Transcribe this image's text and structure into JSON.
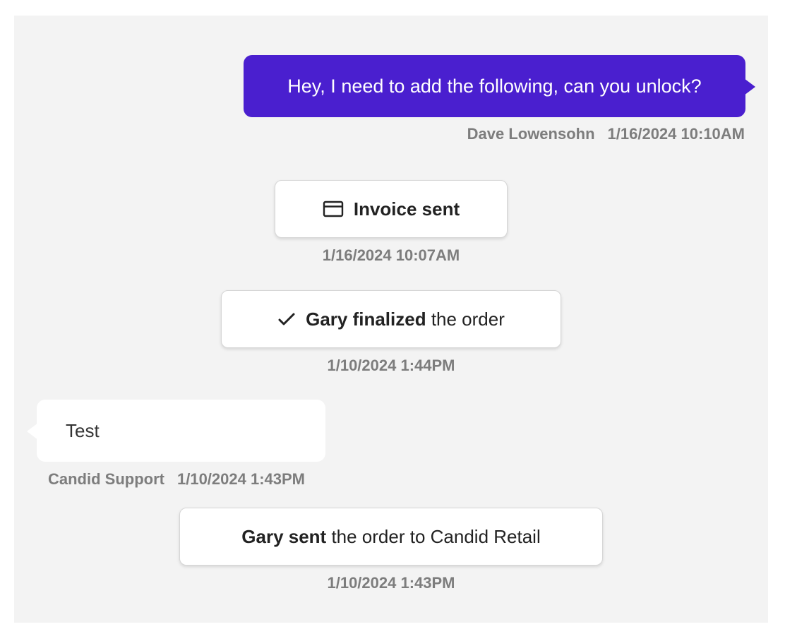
{
  "conversation": {
    "outgoing_message": {
      "text": "Hey, I need to add the following, can you unlock?",
      "author": "Dave Lowensohn",
      "timestamp": "1/16/2024 10:10AM"
    },
    "invoice_event": {
      "icon": "credit-card-icon",
      "label": "Invoice sent",
      "timestamp": "1/16/2024 10:07AM"
    },
    "finalized_event": {
      "icon": "check-icon",
      "actor_action": "Gary finalized",
      "rest": " the order",
      "timestamp": "1/10/2024 1:44PM"
    },
    "incoming_message": {
      "text": "Test",
      "author": "Candid Support",
      "timestamp": "1/10/2024 1:43PM"
    },
    "sent_event": {
      "actor_action": "Gary sent",
      "rest": " the order to Candid Retail",
      "timestamp": "1/10/2024 1:43PM"
    },
    "colors": {
      "outgoing_bubble": "#4a1fcf",
      "panel_background": "#f3f3f3",
      "meta_text": "#7d7d7d"
    }
  }
}
